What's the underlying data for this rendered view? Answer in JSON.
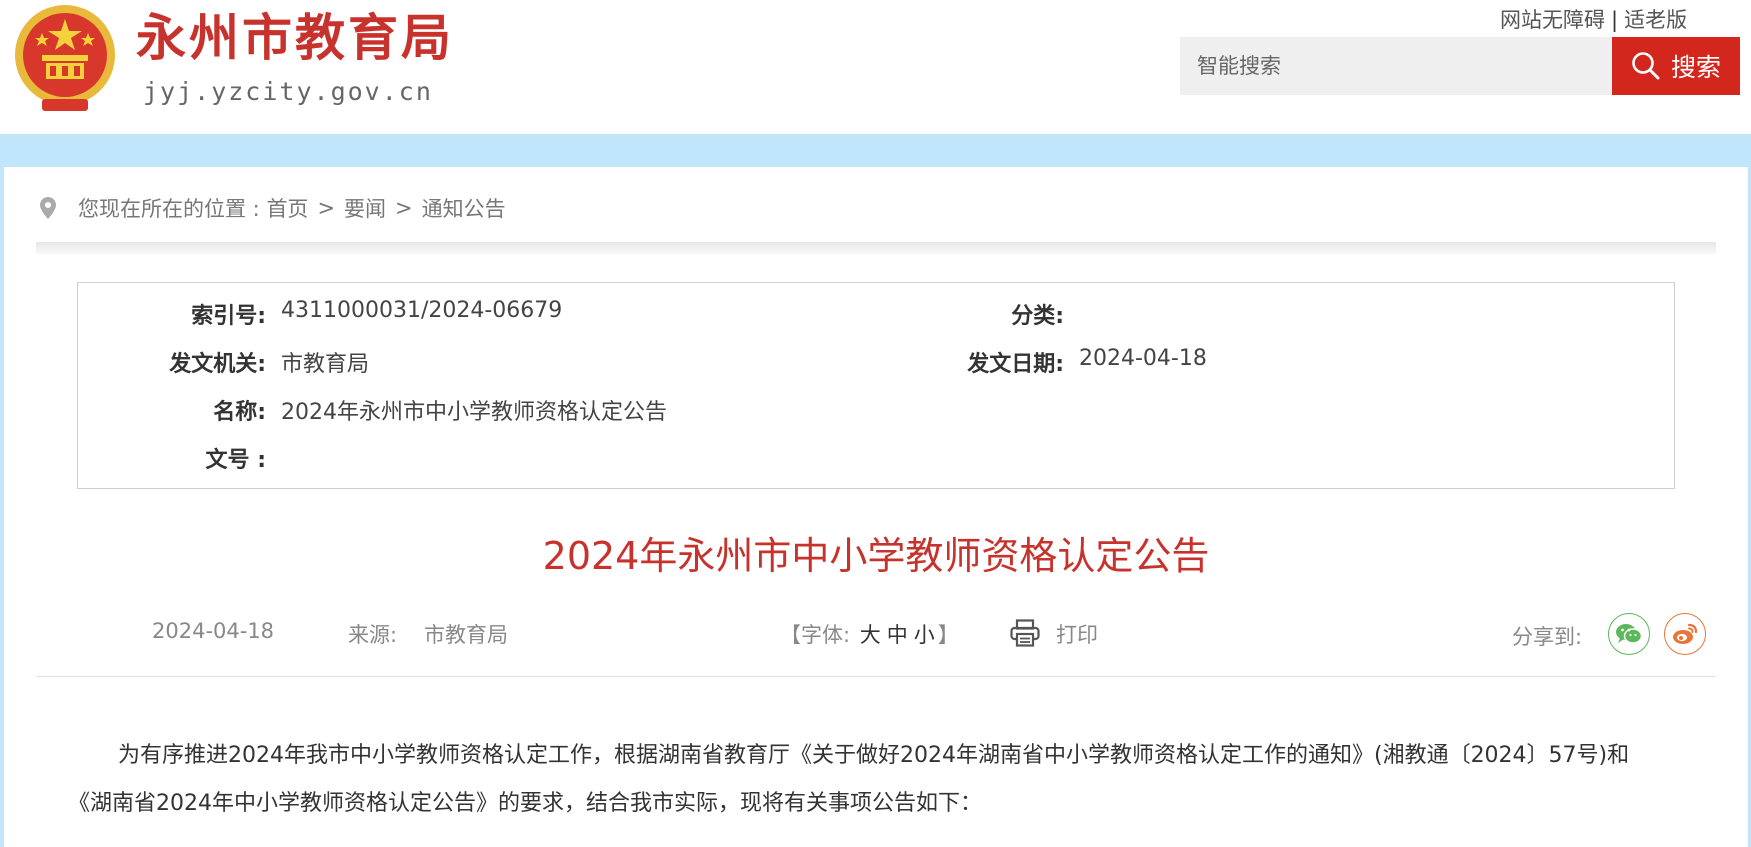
{
  "header": {
    "site_name": "永州市教育局",
    "site_domain": "jyj.yzcity.gov.cn",
    "accessibility_link": "网站无障碍",
    "separator": "|",
    "elderly_mode_link": "适老版",
    "search_placeholder": "智能搜索",
    "search_button": "搜索"
  },
  "breadcrumb": {
    "prefix": "您现在所在的位置 :",
    "items": [
      "首页",
      "要闻",
      "通知公告"
    ],
    "sep": ">"
  },
  "meta": {
    "index_label": "索引号:",
    "index_value": "4311000031/2024-06679",
    "category_label": "分类:",
    "category_value": "",
    "issuer_label": "发文机关:",
    "issuer_value": "市教育局",
    "date_label": "发文日期:",
    "date_value": "2024-04-18",
    "name_label": "名称:",
    "name_value": "2024年永州市中小学教师资格认定公告",
    "docnum_label": "文号 :",
    "docnum_value": ""
  },
  "article": {
    "title": "2024年永州市中小学教师资格认定公告",
    "date": "2024-04-18",
    "source_label": "来源:",
    "source_value": "市教育局",
    "font_prefix": "【字体:",
    "font_large": "大",
    "font_medium": "中",
    "font_small": "小",
    "font_suffix": "】",
    "print_label": "打印",
    "share_label": "分享到:",
    "paragraph_1": "为有序推进2024年我市中小学教师资格认定工作，根据湖南省教育厅《关于做好2024年湖南省中小学教师资格认定工作的通知》(湘教通〔2024〕57号)和《湖南省2024年中小学教师资格认定公告》的要求，结合我市实际，现将有关事项公告如下："
  },
  "icons": {
    "emblem": "national-emblem",
    "search": "search-icon",
    "location": "location-pin-icon",
    "print": "printer-icon",
    "wechat": "wechat-icon",
    "weibo": "weibo-icon"
  },
  "colors": {
    "brand_red": "#c8322c",
    "search_button": "#d3271d",
    "band_blue": "#bfe6fb",
    "wechat_green": "#5cb85c",
    "weibo_orange": "#e8753a"
  }
}
